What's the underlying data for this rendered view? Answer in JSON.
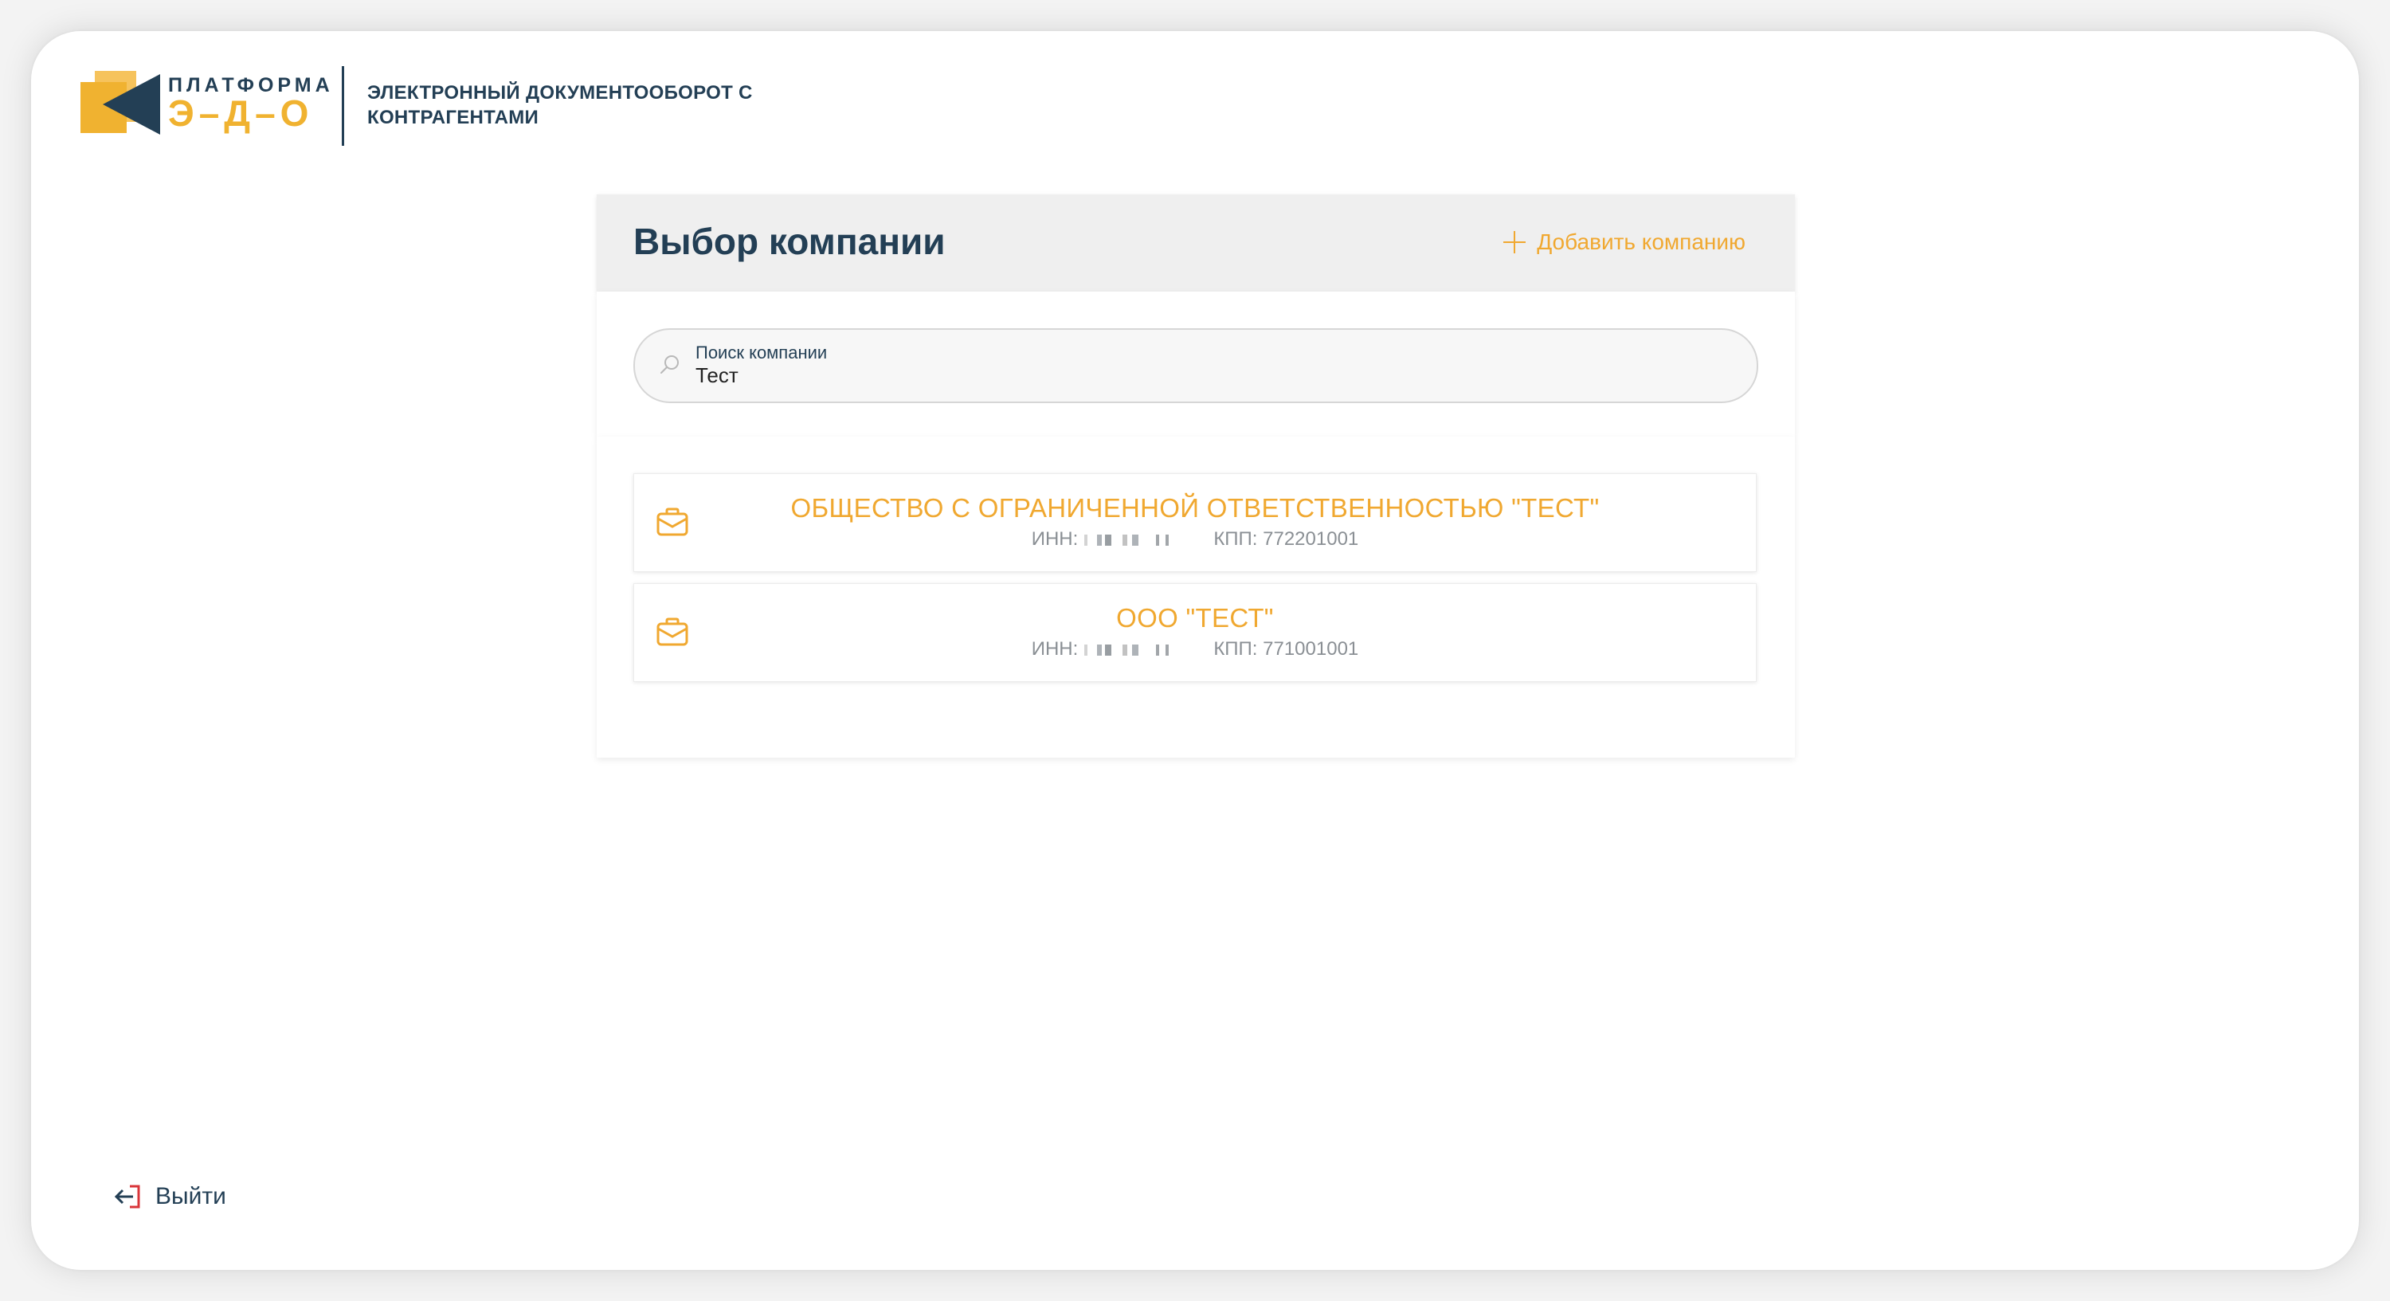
{
  "header": {
    "logo_top": "ПЛАТФОРМА",
    "logo_bottom": "Э–Д–О",
    "caption": "ЭЛЕКТРОННЫЙ ДОКУМЕНТООБОРОТ С КОНТРАГЕНТАМИ"
  },
  "panel": {
    "title": "Выбор компании",
    "add_label": "Добавить компанию"
  },
  "search": {
    "label": "Поиск компании",
    "value": "Тест"
  },
  "companies": [
    {
      "name": "ОБЩЕСТВО С ОГРАНИЧЕННОЙ ОТВЕТСТВЕННОСТЬЮ \"ТЕСТ\"",
      "inn_label": "ИНН:",
      "kpp": "КПП: 772201001"
    },
    {
      "name": "ООО \"ТЕСТ\"",
      "inn_label": "ИНН:",
      "kpp": "КПП: 771001001"
    }
  ],
  "footer": {
    "logout_label": "Выйти"
  },
  "colors": {
    "brand_dark": "#233f55",
    "brand_accent": "#f0a830",
    "header_bg": "#efefef"
  },
  "icons": [
    "logo-icon",
    "plus-icon",
    "search-icon",
    "briefcase-icon",
    "logout-icon"
  ]
}
